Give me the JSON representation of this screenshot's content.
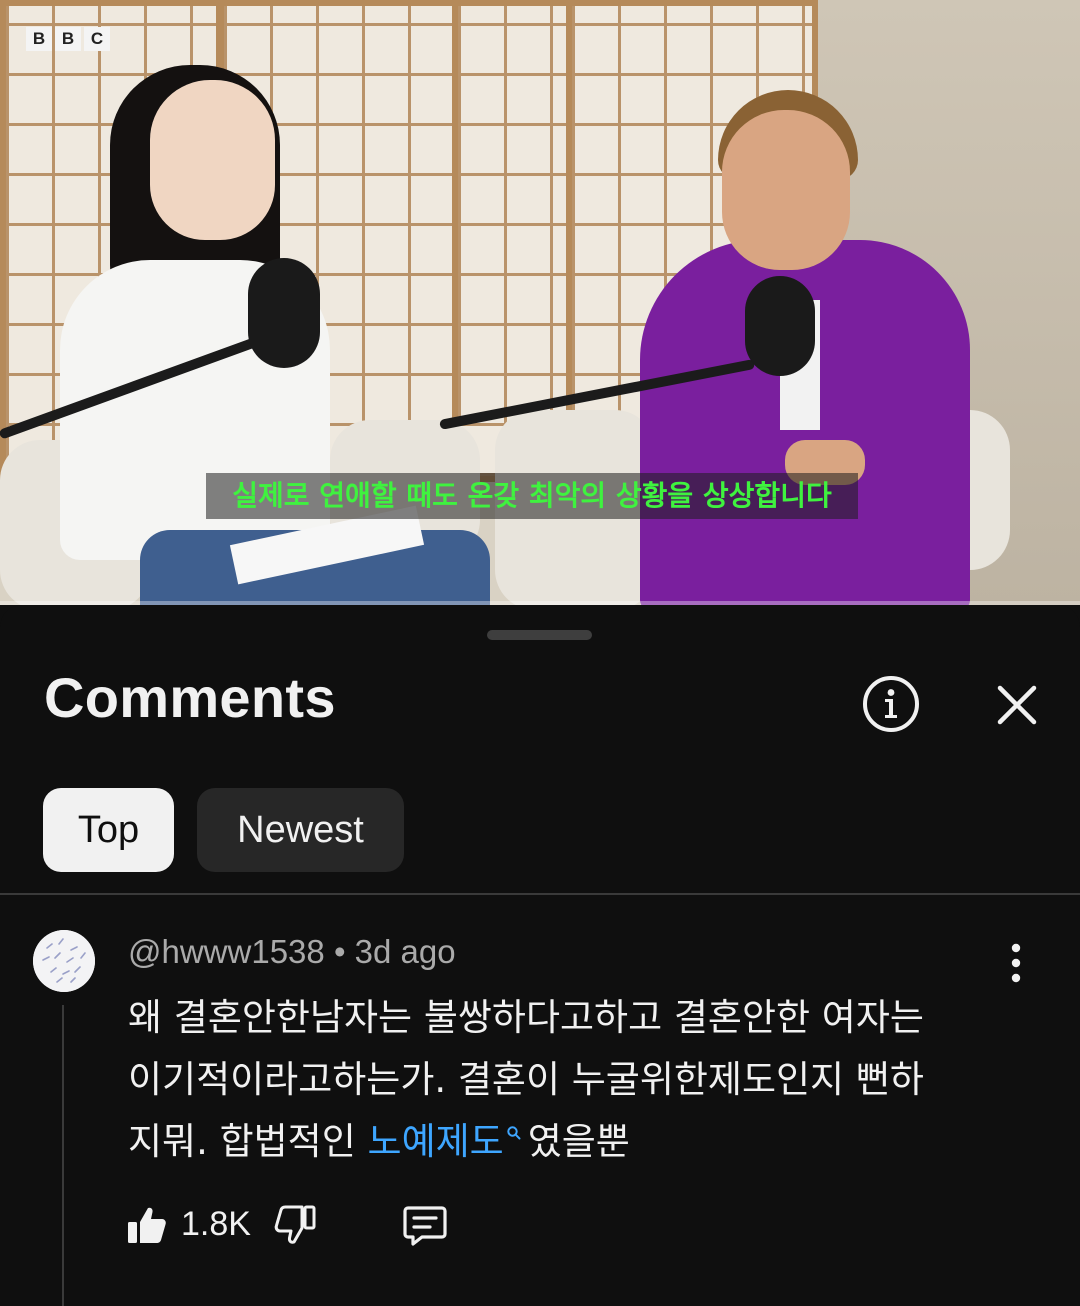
{
  "video": {
    "channel_logo": [
      "B",
      "B",
      "C"
    ],
    "subtitle": "실제로 연애할 때도 온갖 최악의 상황을 상상합니다"
  },
  "comments_panel": {
    "title": "Comments",
    "info_icon": "info-icon",
    "close_icon": "close-icon",
    "sort_chips": [
      {
        "label": "Top",
        "selected": true
      },
      {
        "label": "Newest",
        "selected": false
      }
    ]
  },
  "comment": {
    "author": "@hwww1538",
    "separator": "•",
    "time": "3d ago",
    "lines": {
      "line1": "왜 결혼안한남자는 불쌍하다고하고 결혼안한 여자는",
      "line2": "이기적이라고하는가. 결혼이 누굴위한제도인지 뻔하",
      "line3_pre": "지뭐. 합법적인 ",
      "line3_link": "노예제도",
      "line3_post": "였을뿐"
    },
    "like_count": "1.8K",
    "icons": {
      "like": "thumbs-up-icon",
      "dislike": "thumbs-down-icon",
      "reply": "reply-icon",
      "more": "more-vert-icon"
    },
    "link_color": "#3ea6ff"
  }
}
